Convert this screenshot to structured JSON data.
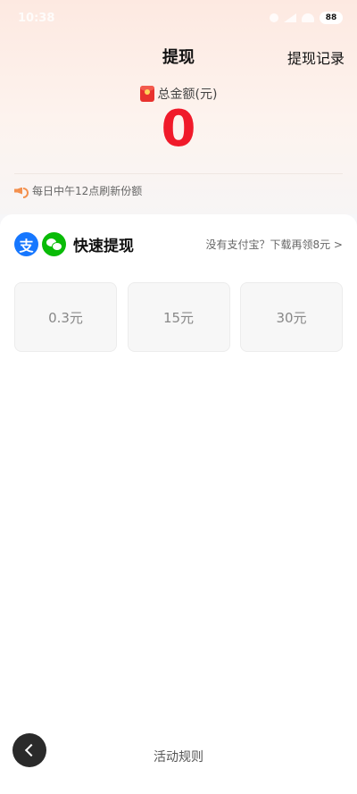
{
  "status": {
    "time": "10:38",
    "battery": "88"
  },
  "header": {
    "title": "提现",
    "record_label": "提现记录"
  },
  "balance": {
    "label": "总金额(元)",
    "value": "0"
  },
  "notice": {
    "text": "每日中午12点刷新份额"
  },
  "quick": {
    "title": "快速提现",
    "link_text": "没有支付宝？下载再领8元 >",
    "alipay_glyph": "支"
  },
  "options": [
    {
      "label": "0.3元"
    },
    {
      "label": "15元"
    },
    {
      "label": "30元"
    }
  ],
  "footer": {
    "rules_label": "活动规则"
  },
  "colors": {
    "accent": "#f01a2a",
    "alipay": "#1677ff",
    "wechat": "#09bb07"
  }
}
